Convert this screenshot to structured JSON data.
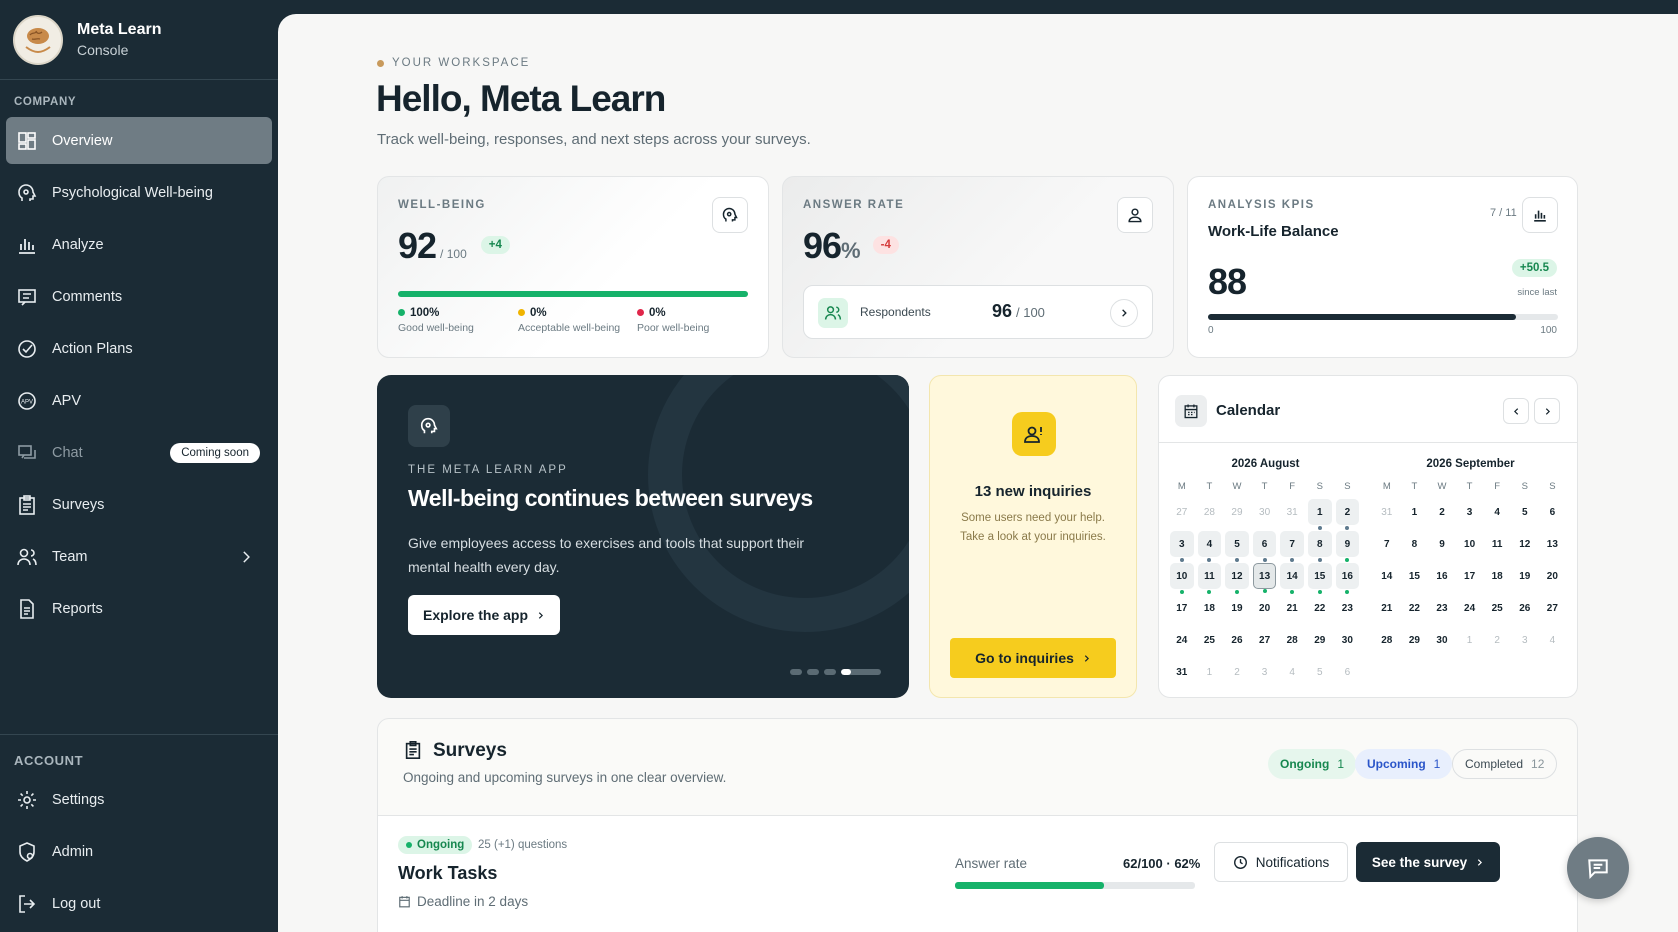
{
  "brand": {
    "name": "Meta Learn",
    "subtitle": "Console"
  },
  "sidebar": {
    "company_label": "COMPANY",
    "items": [
      {
        "label": "Overview",
        "icon": "grid-icon"
      },
      {
        "label": "Psychological Well-being",
        "icon": "head-icon"
      },
      {
        "label": "Analyze",
        "icon": "bar-chart-icon"
      },
      {
        "label": "Comments",
        "icon": "comment-icon"
      },
      {
        "label": "Action Plans",
        "icon": "check-circle-icon"
      },
      {
        "label": "APV",
        "icon": "apv-icon"
      },
      {
        "label": "Chat",
        "icon": "chat-icon",
        "badge": "Coming soon"
      },
      {
        "label": "Surveys",
        "icon": "clipboard-icon"
      },
      {
        "label": "Team",
        "icon": "team-icon"
      },
      {
        "label": "Reports",
        "icon": "document-icon"
      }
    ],
    "account_label": "ACCOUNT",
    "account_items": [
      {
        "label": "Settings",
        "icon": "gear-icon"
      },
      {
        "label": "Admin",
        "icon": "admin-icon"
      },
      {
        "label": "Log out",
        "icon": "logout-icon"
      }
    ]
  },
  "header": {
    "workspace_label": "YOUR WORKSPACE",
    "title": "Hello, Meta Learn",
    "subtitle": "Track well-being, responses, and next steps across your surveys."
  },
  "wellbeing": {
    "label": "WELL-BEING",
    "value": "92",
    "max": "/ 100",
    "delta": "+4",
    "progress": 1.0,
    "legend": [
      {
        "pct": "100%",
        "text": "Good well-being",
        "color": "#16b26a"
      },
      {
        "pct": "0%",
        "text": "Acceptable well-being",
        "color": "#f0b400"
      },
      {
        "pct": "0%",
        "text": "Poor well-being",
        "color": "#e0264a"
      }
    ]
  },
  "answer_rate": {
    "label": "ANSWER RATE",
    "value": "96",
    "unit": "%",
    "delta": "-4",
    "respondents_label": "Respondents",
    "respondents_value": "96",
    "respondents_max": "/ 100"
  },
  "kpis": {
    "label": "ANALYSIS KPIS",
    "pager": "7 / 11",
    "name": "Work-Life Balance",
    "value": "88",
    "delta": "+50.5",
    "delta_note": "since last",
    "min": "0",
    "max": "100",
    "progress": 0.88
  },
  "promo": {
    "label": "THE META LEARN APP",
    "title": "Well-being continues between surveys",
    "text": "Give employees access to exercises and tools that support their mental health every day.",
    "button": "Explore the app"
  },
  "inquiries": {
    "title": "13 new inquiries",
    "text_line1": "Some users need your help.",
    "text_line2": "Take a look at your inquiries.",
    "button": "Go to inquiries"
  },
  "calendar": {
    "title": "Calendar",
    "weekdays": [
      "M",
      "T",
      "W",
      "T",
      "F",
      "S",
      "S"
    ],
    "months": [
      {
        "title": "2026 August",
        "weeks": [
          [
            [
              "27",
              "o"
            ],
            [
              "28",
              "o"
            ],
            [
              "29",
              "o"
            ],
            [
              "30",
              "o"
            ],
            [
              "31",
              "o"
            ],
            [
              "1",
              "ev",
              "#5e7a8e"
            ],
            [
              "2",
              "ev",
              "#5e7a8e"
            ]
          ],
          [
            [
              "3",
              "ev",
              "#5e7a8e"
            ],
            [
              "4",
              "ev",
              "#5e7a8e"
            ],
            [
              "5",
              "ev",
              "#5e7a8e"
            ],
            [
              "6",
              "ev",
              "#5e7a8e"
            ],
            [
              "7",
              "ev",
              "#5e7a8e"
            ],
            [
              "8",
              "ev",
              "#5e7a8e"
            ],
            [
              "9",
              "ev",
              "#16b26a"
            ]
          ],
          [
            [
              "10",
              "ev",
              "#16b26a"
            ],
            [
              "11",
              "ev",
              "#16b26a"
            ],
            [
              "12",
              "ev",
              "#16b26a"
            ],
            [
              "13",
              "today",
              "#16b26a"
            ],
            [
              "14",
              "ev",
              "#16b26a"
            ],
            [
              "15",
              "ev",
              "#16b26a"
            ],
            [
              "16",
              "ev",
              "#16b26a"
            ]
          ],
          [
            [
              "17",
              ""
            ],
            [
              "18",
              ""
            ],
            [
              "19",
              ""
            ],
            [
              "20",
              ""
            ],
            [
              "21",
              ""
            ],
            [
              "22",
              ""
            ],
            [
              "23",
              ""
            ]
          ],
          [
            [
              "24",
              ""
            ],
            [
              "25",
              ""
            ],
            [
              "26",
              ""
            ],
            [
              "27",
              ""
            ],
            [
              "28",
              ""
            ],
            [
              "29",
              ""
            ],
            [
              "30",
              ""
            ]
          ],
          [
            [
              "31",
              ""
            ],
            [
              "1",
              "o"
            ],
            [
              "2",
              "o"
            ],
            [
              "3",
              "o"
            ],
            [
              "4",
              "o"
            ],
            [
              "5",
              "o"
            ],
            [
              "6",
              "o"
            ]
          ]
        ]
      },
      {
        "title": "2026 September",
        "weeks": [
          [
            [
              "31",
              "o"
            ],
            [
              "1",
              ""
            ],
            [
              "2",
              ""
            ],
            [
              "3",
              ""
            ],
            [
              "4",
              ""
            ],
            [
              "5",
              ""
            ],
            [
              "6",
              ""
            ]
          ],
          [
            [
              "7",
              ""
            ],
            [
              "8",
              ""
            ],
            [
              "9",
              ""
            ],
            [
              "10",
              ""
            ],
            [
              "11",
              ""
            ],
            [
              "12",
              ""
            ],
            [
              "13",
              ""
            ]
          ],
          [
            [
              "14",
              ""
            ],
            [
              "15",
              ""
            ],
            [
              "16",
              ""
            ],
            [
              "17",
              ""
            ],
            [
              "18",
              ""
            ],
            [
              "19",
              ""
            ],
            [
              "20",
              ""
            ]
          ],
          [
            [
              "21",
              ""
            ],
            [
              "22",
              ""
            ],
            [
              "23",
              ""
            ],
            [
              "24",
              ""
            ],
            [
              "25",
              ""
            ],
            [
              "26",
              ""
            ],
            [
              "27",
              ""
            ]
          ],
          [
            [
              "28",
              ""
            ],
            [
              "29",
              ""
            ],
            [
              "30",
              ""
            ],
            [
              "1",
              "o"
            ],
            [
              "2",
              "o"
            ],
            [
              "3",
              "o"
            ],
            [
              "4",
              "o"
            ]
          ]
        ]
      }
    ]
  },
  "surveys": {
    "title": "Surveys",
    "subtitle": "Ongoing and upcoming surveys in one clear overview.",
    "tabs": [
      {
        "label": "Ongoing",
        "count": "1"
      },
      {
        "label": "Upcoming",
        "count": "1"
      },
      {
        "label": "Completed",
        "count": "12"
      }
    ],
    "row": {
      "status": "Ongoing",
      "questions": "25 (+1) questions",
      "name": "Work Tasks",
      "deadline": "Deadline in 2 days",
      "answer_label": "Answer rate",
      "answer_value": "62/100 · 62%",
      "progress": 0.62,
      "notifications": "Notifications",
      "cta": "See the survey"
    }
  },
  "colors": {
    "accent_dark": "#1b2b35",
    "green": "#16b26a",
    "yellow": "#f6cc1e"
  }
}
